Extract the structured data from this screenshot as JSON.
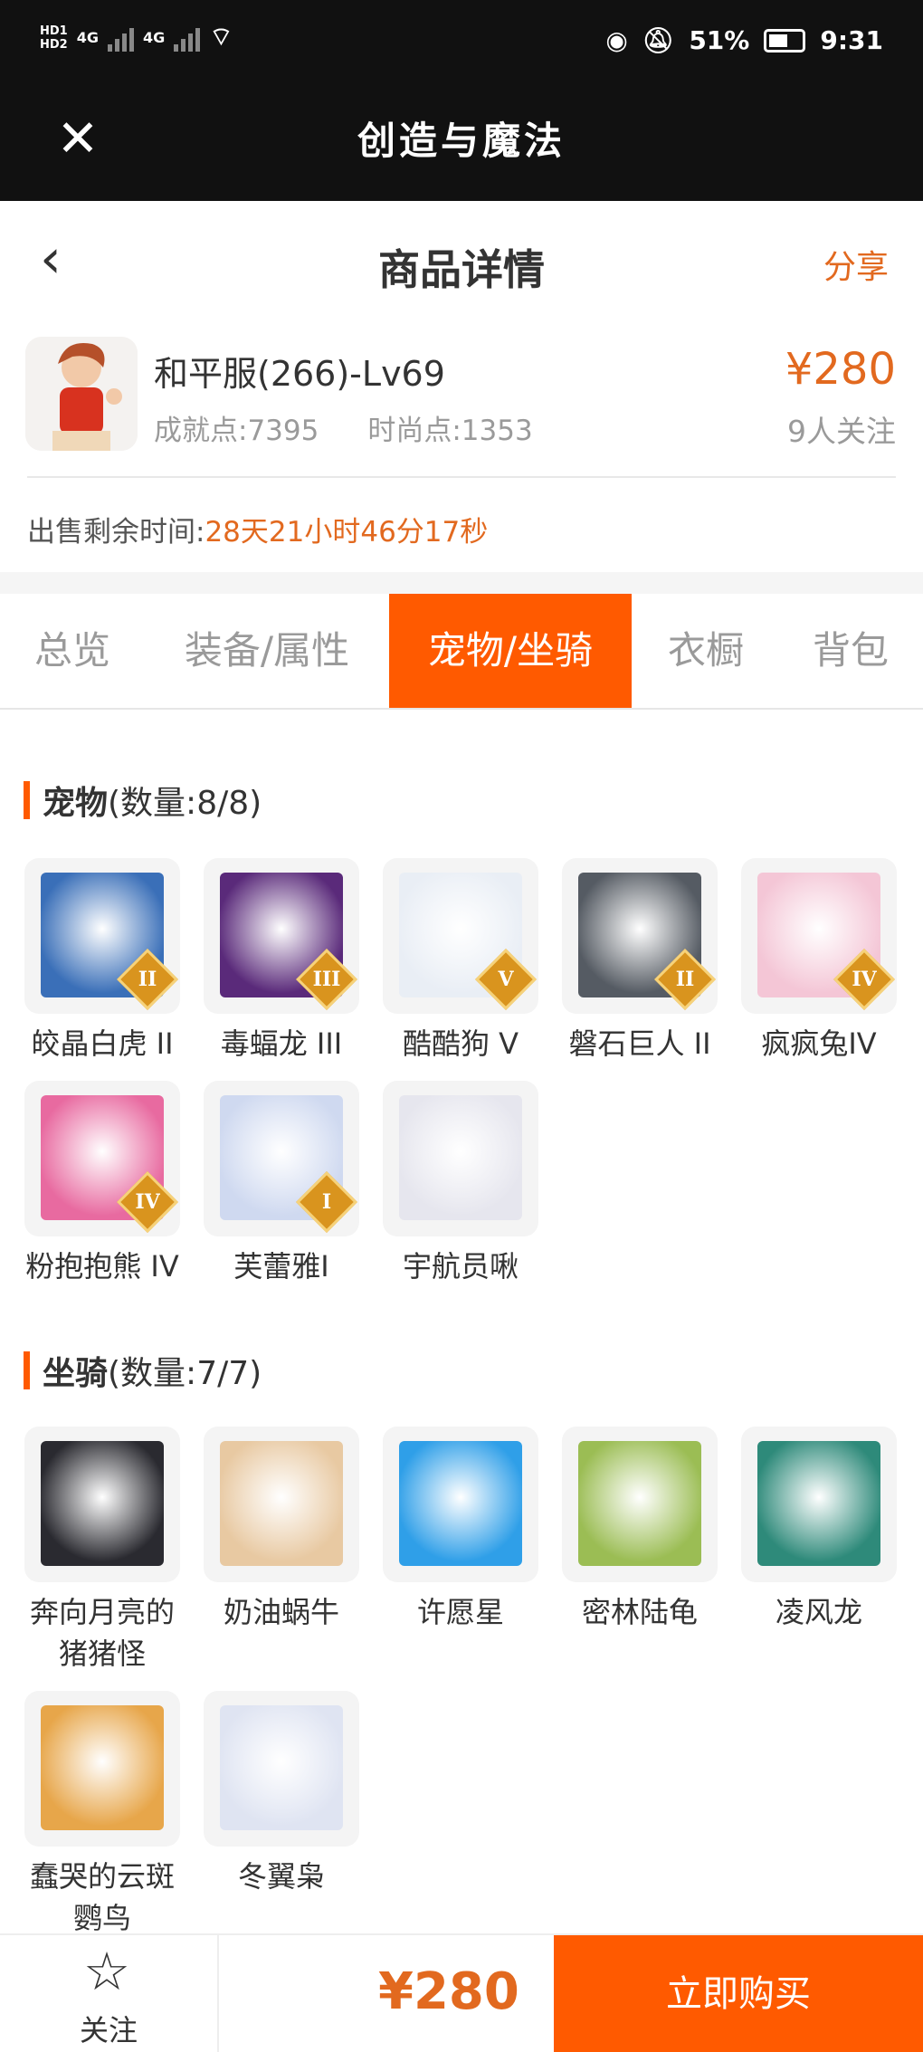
{
  "status_bar": {
    "left_text": "4G",
    "left_text2": "4G",
    "hd1": "HD1",
    "hd2": "HD2",
    "battery": "51%",
    "time": "9:31"
  },
  "app": {
    "title": "创造与魔法"
  },
  "header": {
    "title": "商品详情",
    "share": "分享"
  },
  "product": {
    "name": "和平服(266)-Lv69",
    "achievement": "成就点:7395",
    "fashion": "时尚点:1353",
    "price": "¥280",
    "followers": "9人关注",
    "remaining_label": "出售剩余时间:",
    "remaining_time": "28天21小时46分17秒"
  },
  "tabs": [
    {
      "label": "总览"
    },
    {
      "label": "装备/属性"
    },
    {
      "label": "宠物/坐骑",
      "active": true
    },
    {
      "label": "衣橱"
    },
    {
      "label": "背包"
    }
  ],
  "pets": {
    "title": "宠物",
    "count": "(数量:8/8)",
    "items": [
      {
        "name": "皎晶白虎 II",
        "badge": "II",
        "color": "#3a6fb8"
      },
      {
        "name": "毒蝠龙 III",
        "badge": "III",
        "color": "#5a2a7a"
      },
      {
        "name": "酷酷狗 V",
        "badge": "V",
        "color": "#e9eef5"
      },
      {
        "name": "磐石巨人 II",
        "badge": "II",
        "color": "#555b63"
      },
      {
        "name": "疯疯兔IV",
        "badge": "IV",
        "color": "#f4c6d6"
      },
      {
        "name": "粉抱抱熊 IV",
        "badge": "IV",
        "color": "#e86aa0"
      },
      {
        "name": "芙蕾雅I",
        "badge": "I",
        "color": "#cfd9f0"
      },
      {
        "name": "宇航员啾",
        "badge": "",
        "color": "#e6e6ee"
      }
    ]
  },
  "mounts": {
    "title": "坐骑",
    "count": "(数量:7/7)",
    "items": [
      {
        "name": "奔向月亮的猪猪怪",
        "color": "#2a2a30"
      },
      {
        "name": "奶油蜗牛",
        "color": "#e8c9a2"
      },
      {
        "name": "许愿星",
        "color": "#2f9fe8"
      },
      {
        "name": "密林陆龟",
        "color": "#9bbd54"
      },
      {
        "name": "凌风龙",
        "color": "#2e8a7a"
      },
      {
        "name": "蠢哭的云斑鹦鸟",
        "color": "#e7a64a"
      },
      {
        "name": "冬翼枭",
        "color": "#dfe4f2"
      }
    ]
  },
  "bottom": {
    "follow": "关注",
    "price": "¥280",
    "buy": "立即购买"
  },
  "colors": {
    "accent": "#ff5a00",
    "price": "#e2691f",
    "dark": "#111111"
  }
}
